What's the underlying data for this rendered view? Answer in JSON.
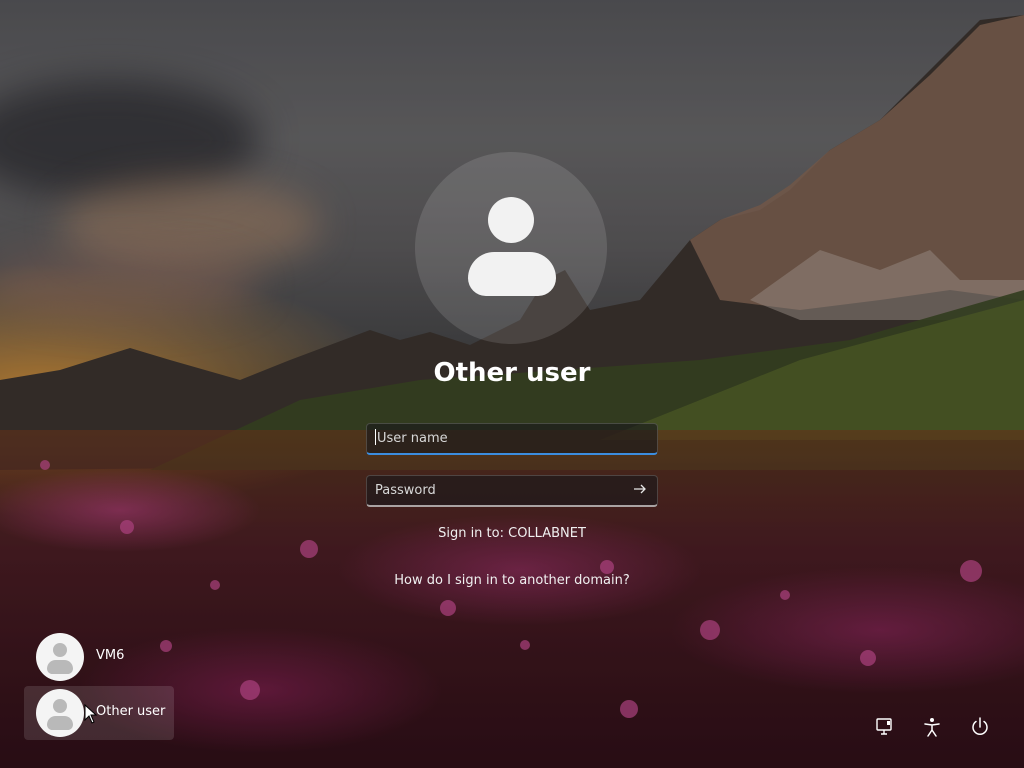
{
  "login": {
    "user_title": "Other user",
    "username_placeholder": "User name",
    "password_placeholder": "Password",
    "sign_in_to": "Sign in to: COLLABNET",
    "domain_help_link": "How do I sign in to another domain?"
  },
  "users": [
    {
      "name": "VM6",
      "selected": false
    },
    {
      "name": "Other user",
      "selected": true
    }
  ],
  "system_buttons": {
    "network_icon": "network-icon",
    "accessibility_icon": "accessibility-icon",
    "power_icon": "power-icon"
  },
  "colors": {
    "focus_underline": "#3b8ee0"
  }
}
